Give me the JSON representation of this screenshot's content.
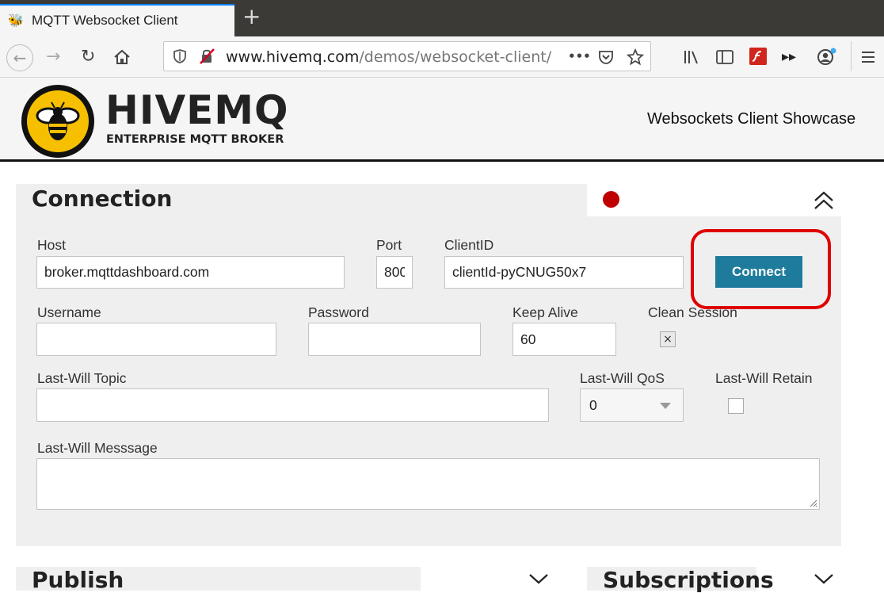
{
  "browser": {
    "tab_title": "MQTT Websocket Client",
    "tab_close": "×",
    "new_tab": "+",
    "url_domain": "www.hivemq.com",
    "url_path": "/demos/websocket-client/",
    "url_more": "•••"
  },
  "header": {
    "logo_text": "HIVEMQ",
    "logo_subtitle": "ENTERPRISE MQTT BROKER",
    "showcase": "Websockets Client Showcase"
  },
  "connection": {
    "title": "Connection",
    "status_color": "#c00000",
    "host_label": "Host",
    "host_value": "broker.mqttdashboard.com",
    "port_label": "Port",
    "port_value": "800",
    "clientid_label": "ClientID",
    "clientid_value": "clientId-pyCNUG50x7",
    "connect_label": "Connect",
    "username_label": "Username",
    "username_value": "",
    "password_label": "Password",
    "password_value": "",
    "keepalive_label": "Keep Alive",
    "keepalive_value": "60",
    "clean_session_label": "Clean Session",
    "clean_session_checked": "×",
    "lastwill_topic_label": "Last-Will Topic",
    "lastwill_topic_value": "",
    "lastwill_qos_label": "Last-Will QoS",
    "lastwill_qos_value": "0",
    "lastwill_retain_label": "Last-Will Retain",
    "lastwill_message_label": "Last-Will Messsage",
    "lastwill_message_value": ""
  },
  "publish": {
    "title": "Publish"
  },
  "subscriptions": {
    "title": "Subscriptions"
  },
  "colors": {
    "accent": "#1e7b9c",
    "highlight_ring": "#e00000",
    "tab_indicator": "#0a84ff"
  }
}
